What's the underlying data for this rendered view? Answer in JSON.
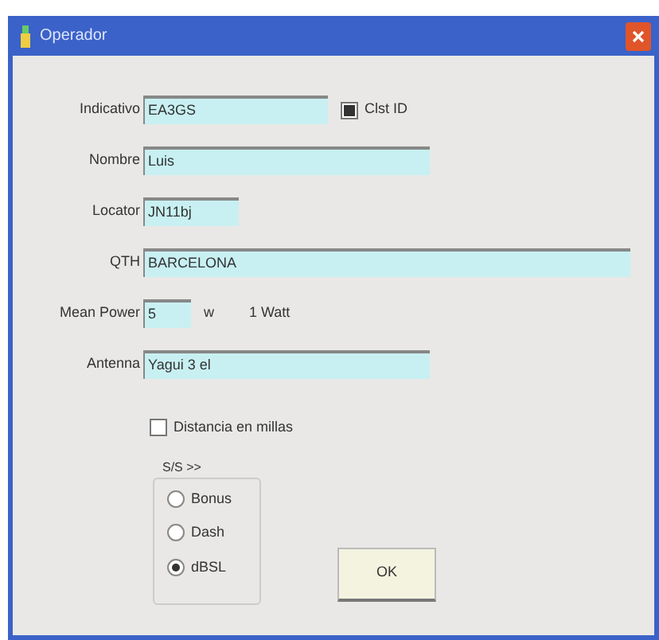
{
  "window": {
    "title": "Operador"
  },
  "fields": [
    {
      "label": "Indicativo",
      "value": "EA3GS"
    },
    {
      "label": "Nombre",
      "value": "Luis"
    },
    {
      "label": "Locator",
      "value": "JN11bj"
    },
    {
      "label": "QTH",
      "value": "BARCELONA"
    },
    {
      "label": "Mean Power",
      "value": "5",
      "unit": "w",
      "note": "1 Watt"
    },
    {
      "label": "Antenna",
      "value": "Yagui 3 el"
    }
  ],
  "id_checkbox": {
    "label": "Clst ID",
    "checked": true
  },
  "miles_checkbox": {
    "label": "Distancia en millas",
    "checked": false
  },
  "group": {
    "title": "S/S >>",
    "options": [
      {
        "label": "Bonus",
        "selected": false
      },
      {
        "label": "Dash",
        "selected": false
      },
      {
        "label": "dBSL",
        "selected": true
      }
    ]
  },
  "ok_button": "OK"
}
